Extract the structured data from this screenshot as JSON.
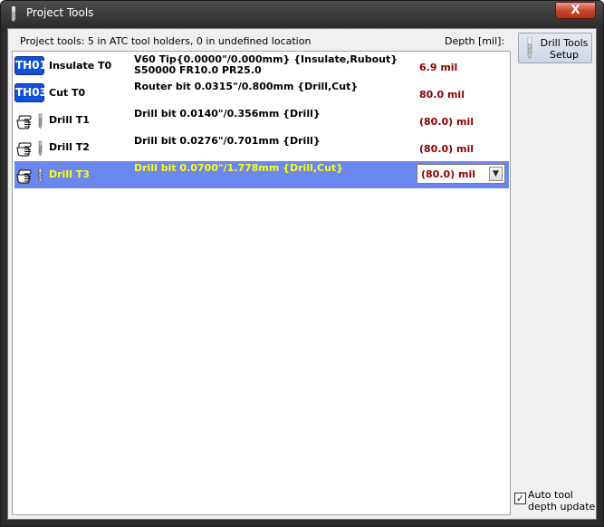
{
  "window": {
    "title": "Project Tools",
    "close_label": "X"
  },
  "header": {
    "info": "Project tools: 5 in ATC tool holders, 0 in undefined location",
    "depth_label": "Depth [mil]:"
  },
  "tools": [
    {
      "badge": "TH01",
      "name": "Insulate T0",
      "desc_line1": "V60  Tip{0.0000\"/0.000mm} {Insulate,Rubout}",
      "desc_line2": "S50000 FR10.0 PR25.0",
      "depth": "6.9 mil"
    },
    {
      "badge": "TH03",
      "name": "Cut T0",
      "desc_line1": "Router bit 0.0315\"/0.800mm {Drill,Cut}",
      "depth": "80.0 mil"
    },
    {
      "name": "Drill T1",
      "desc_line1": "Drill bit 0.0140\"/0.356mm {Drill}",
      "depth": "(80.0) mil"
    },
    {
      "name": "Drill T2",
      "desc_line1": "Drill bit 0.0276\"/0.701mm {Drill}",
      "depth": "(80.0) mil"
    },
    {
      "name": "Drill T3",
      "desc_line1": "Drill bit 0.0700\"/1.778mm {Drill,Cut}",
      "depth": "(80.0) mil",
      "selected": true
    }
  ],
  "sidebar": {
    "drill_setup_line1": "Drill Tools",
    "drill_setup_line2": "Setup",
    "auto_depth_label": "Auto tool depth update",
    "auto_depth_checked": true,
    "check_glyph": "✓"
  },
  "colors": {
    "selection": "#6b87f0",
    "selected_text": "#ffff00",
    "depth_text": "#8b0000",
    "badge": "#1150d8"
  }
}
